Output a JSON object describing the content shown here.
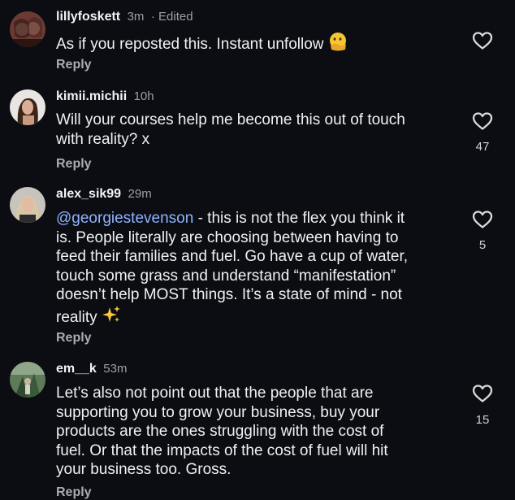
{
  "comments": [
    {
      "username": "lillyfoskett",
      "time": "3m",
      "edited": "· Edited",
      "text": "As if you reposted this. Instant unfollow",
      "emoji": "face-with-hand-over-mouth",
      "reply": "Reply",
      "likes": ""
    },
    {
      "username": "kimii.michii",
      "time": "10h",
      "text_line1": "Will your courses help me become this out of touch",
      "text_line2": "with reality? x",
      "reply": "Reply",
      "likes": "47"
    },
    {
      "username": "alex_sik99",
      "time": "29m",
      "mention": "@georgiestevenson",
      "text_line1": " - this is not the flex you think it",
      "text_line2": "is. People literally are choosing between having to",
      "text_line3": "feed their families and fuel. Go have a cup of water,",
      "text_line4": "touch some grass and understand “manifestation”",
      "text_line5": "doesn’t help MOST things. It’s a state of mind - not",
      "text_line6": "reality",
      "emoji": "sparkles",
      "reply": "Reply",
      "likes": "5"
    },
    {
      "username": "em__k",
      "time": "53m",
      "text_line1": "Let’s also not point out that the people that are",
      "text_line2": "supporting you to grow your business, buy your",
      "text_line3": "products are the ones struggling with the cost of",
      "text_line4": "fuel. Or that the impacts of the cost of fuel will hit",
      "text_line5": "your business too. Gross.",
      "reply": "Reply",
      "likes": "15"
    }
  ],
  "colors": {
    "background": "#0b0d12",
    "mention": "#8fb3ff",
    "secondary_text": "#9aa0a8"
  }
}
